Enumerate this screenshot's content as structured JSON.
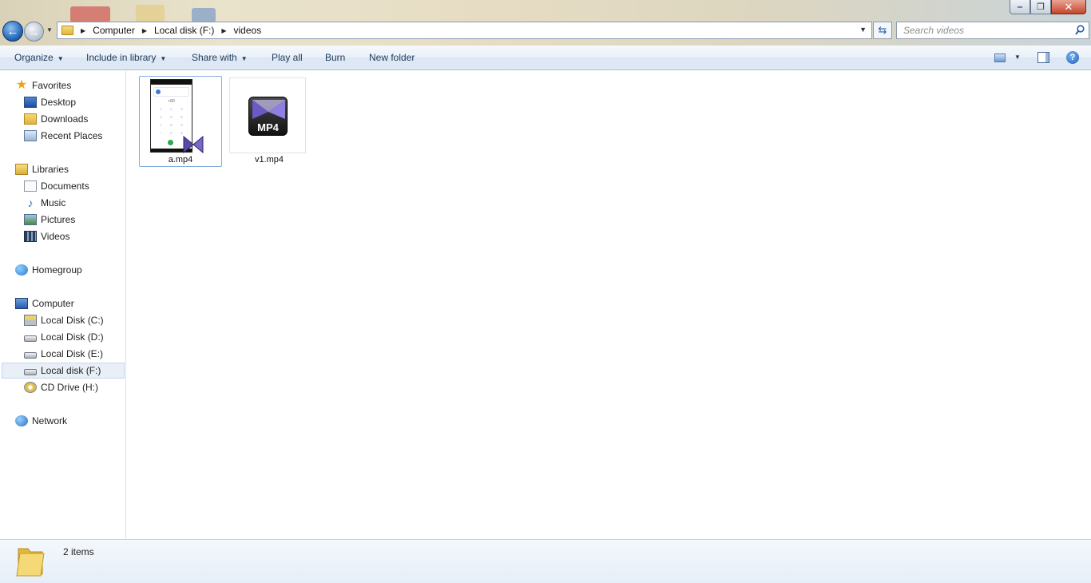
{
  "window": {
    "minimize_glyph": "‒",
    "maximize_glyph": "❐",
    "close_glyph": "✕"
  },
  "address_bar": {
    "crumbs": [
      "Computer",
      "Local disk (F:)",
      "videos"
    ]
  },
  "search": {
    "placeholder": "Search videos"
  },
  "toolbar": {
    "organize": "Organize",
    "include_in_library": "Include in library",
    "share_with": "Share with",
    "play_all": "Play all",
    "burn": "Burn",
    "new_folder": "New folder"
  },
  "nav_pane": {
    "favorites": {
      "label": "Favorites",
      "items": [
        "Desktop",
        "Downloads",
        "Recent Places"
      ]
    },
    "libraries": {
      "label": "Libraries",
      "items": [
        "Documents",
        "Music",
        "Pictures",
        "Videos"
      ]
    },
    "homegroup": "Homegroup",
    "computer": {
      "label": "Computer",
      "items": [
        "Local Disk (C:)",
        "Local Disk (D:)",
        "Local Disk (E:)",
        "Local disk (F:)",
        "CD Drive (H:)"
      ],
      "selected": "Local disk (F:)"
    },
    "network": "Network"
  },
  "files": [
    {
      "name": "a.mp4",
      "thumbnail": "phone-screenshot-thumbnail",
      "selected": true
    },
    {
      "name": "v1.mp4",
      "thumbnail": "mp4-icon",
      "selected": false
    }
  ],
  "mp4_badge": "MP4",
  "details_pane": {
    "item_count": "2 items"
  },
  "icons": {
    "back": "←",
    "forward": "→",
    "refresh": "⇆",
    "help": "?"
  },
  "colors": {
    "accent": "#1e395b",
    "selection_border": "#84acdd",
    "selection_bg": "#e8eff7"
  }
}
